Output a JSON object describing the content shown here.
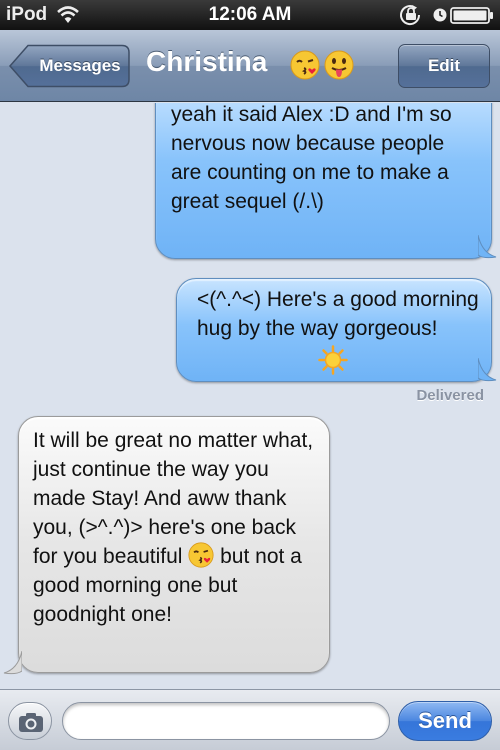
{
  "status_bar": {
    "carrier": "iPod",
    "time": "12:06 AM",
    "icons": [
      "wifi-icon",
      "orientation-lock-icon",
      "alarm-icon",
      "battery-icon"
    ]
  },
  "nav": {
    "back_label": "Messages",
    "title": "Christina",
    "title_emojis": [
      "kissing-face-emoji",
      "tongue-face-emoji"
    ],
    "edit_label": "Edit"
  },
  "messages": [
    {
      "direction": "outgoing",
      "text": "yeah it said Alex :D and I'm so nervous now because people are counting on me to make a great sequel (/.\\)"
    },
    {
      "direction": "outgoing",
      "text": "<(^.^<) Here's a good morning hug by the way gorgeous!",
      "trailing_emoji": "sun-emoji"
    },
    {
      "direction": "incoming",
      "text_before_emoji": "It will be great no matter what, just continue the way you made Stay! And aww thank you, (>^.^)> here's one back for you beautiful",
      "inline_emoji": "kissing-face-emoji",
      "text_after_emoji": "but not a good morning one but goodnight one!"
    }
  ],
  "delivery_status": "Delivered",
  "input": {
    "value": "",
    "placeholder": "",
    "send_label": "Send"
  },
  "colors": {
    "outgoing_bubble": "#88c3fb",
    "incoming_bubble": "#e6e6e6",
    "nav_bar": "#7a8fac",
    "send_button": "#3a7ce0",
    "background": "#dbe2ed"
  }
}
